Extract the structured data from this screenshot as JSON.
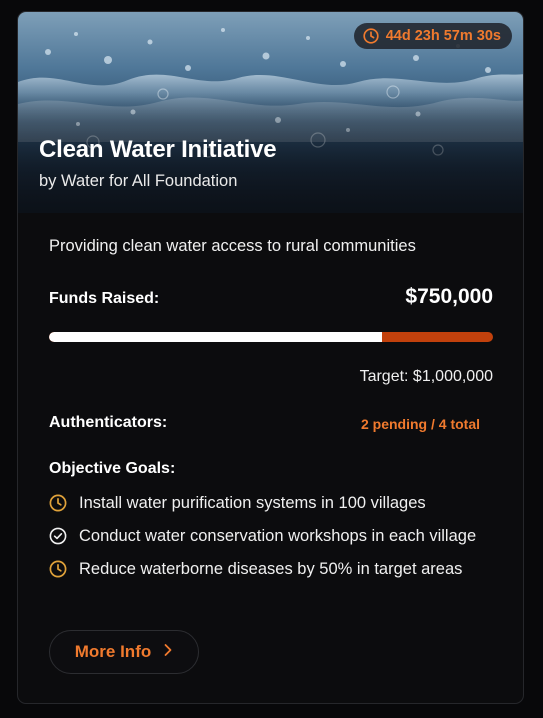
{
  "colors": {
    "accent": "#f07a2e",
    "progress_track": "#c2410c",
    "progress_fill": "#ffffff",
    "card_bg": "#0c0c0e",
    "pending_icon": "#e0a23a"
  },
  "campaign": {
    "countdown": "44d 23h 57m 30s",
    "countdown_icon": "clock-icon",
    "title": "Clean Water Initiative",
    "organizer": "by Water for All Foundation",
    "description": "Providing clean water access to rural communities",
    "funds_label": "Funds Raised:",
    "funds_raised": "$750,000",
    "progress_fraction": 0.75,
    "target": "Target: $1,000,000",
    "authenticators_label": "Authenticators:",
    "authenticators_status": "2 pending / 4 total",
    "goals_label": "Objective Goals:",
    "goals": [
      {
        "text": "Install water purification systems in 100 villages",
        "status": "pending",
        "icon": "clock-icon"
      },
      {
        "text": "Conduct water conservation workshops in each village",
        "status": "completed",
        "icon": "check-circle-icon"
      },
      {
        "text": "Reduce waterborne diseases by 50% in target areas",
        "status": "pending",
        "icon": "clock-icon"
      }
    ],
    "more_info_label": "More Info",
    "more_info_icon": "chevron-right-icon"
  }
}
